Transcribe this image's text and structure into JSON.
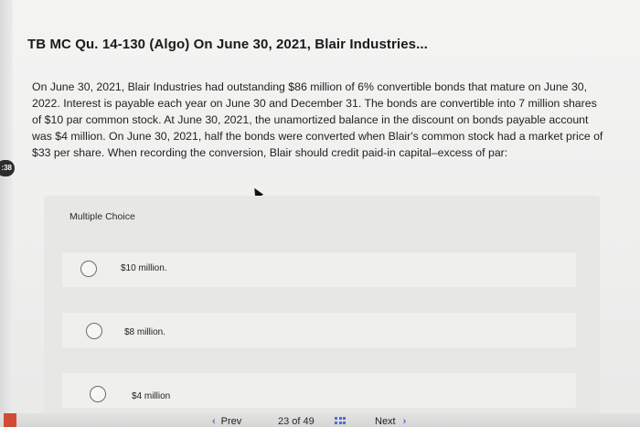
{
  "question": {
    "title": "TB MC Qu. 14-130 (Algo) On June 30, 2021, Blair Industries...",
    "body": "On June 30, 2021, Blair Industries had outstanding $86 million of 6% convertible bonds that mature on June 30, 2022. Interest is payable each year on June 30 and December 31. The bonds are convertible into 7 million shares of $10 par common stock. At June 30, 2021, the unamortized balance in the discount on bonds payable account was $4 million. On June 30, 2021, half the bonds were converted when Blair's common stock had a market price of $33 per share. When recording the conversion, Blair should credit paid-in capital–excess of par:"
  },
  "timer": {
    "value": ":38"
  },
  "choices": {
    "label": "Multiple Choice",
    "options": [
      {
        "text": "$10 million."
      },
      {
        "text": "$8 million."
      },
      {
        "text": "$4 million"
      }
    ]
  },
  "navigation": {
    "prev_label": "Prev",
    "page_text": "23 of 49",
    "next_label": "Next",
    "prev_chevron": "‹",
    "next_chevron": "›"
  },
  "icons": {
    "grid": "grid-icon",
    "cursor": "cursor-arrow-icon"
  },
  "colors": {
    "accent": "#4a6fd6",
    "red_tab": "#d24b36"
  }
}
